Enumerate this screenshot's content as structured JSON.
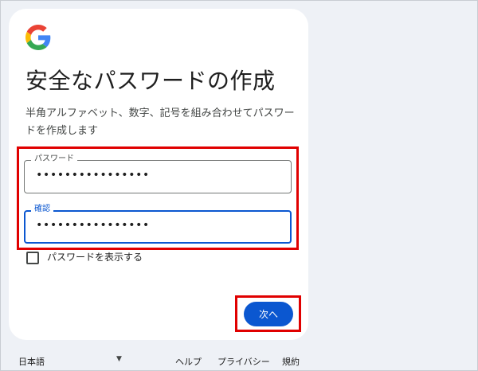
{
  "page": {
    "title": "安全なパスワードの作成",
    "subtitle": "半角アルファベット、数字、記号を組み合わせてパスワードを作成します"
  },
  "logo": {
    "name": "google-logo",
    "colors": [
      "#4285f4",
      "#34a853",
      "#fbbc05",
      "#ea4335"
    ]
  },
  "form": {
    "password": {
      "label": "パスワード",
      "value": "••••••••••••••••"
    },
    "confirm": {
      "label": "確認",
      "value": "••••••••••••••••"
    },
    "show_password": {
      "label": "パスワードを表示する",
      "checked": false
    },
    "next_button": "次へ"
  },
  "footer": {
    "language": "日本語",
    "language_icon": "caret-down-icon",
    "help": "ヘルプ",
    "privacy": "プライバシー",
    "terms": "規約"
  },
  "colors": {
    "accent": "#0b57d0",
    "highlight": "#e00000",
    "background": "#eef1f6",
    "card": "#ffffff"
  }
}
